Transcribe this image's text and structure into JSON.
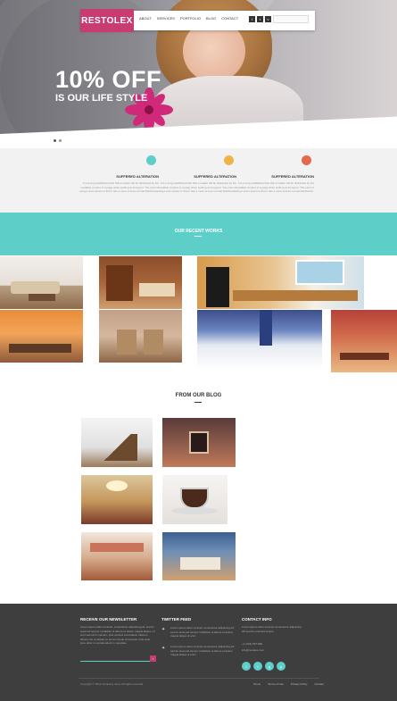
{
  "brand": {
    "logo": "RESTOLEX",
    "accent": "#c83b73",
    "teal": "#5dcfc8"
  },
  "nav": {
    "items": [
      "ABOUT",
      "SERVICES",
      "PORTFOLIO",
      "BLOG",
      "CONTACT"
    ],
    "social_icons": [
      "facebook-icon",
      "twitter-icon",
      "vimeo-icon"
    ]
  },
  "hero": {
    "title": "10% OFF",
    "subtitle": "IS OUR LIFE STYLE",
    "slides": 2,
    "active_slide": 1
  },
  "features": [
    {
      "title": "SUFFERED ALTERATION",
      "icon": "leaf-icon",
      "color": "#5dcfc8",
      "text": "It is a long established fact that a reader will be distracted by the readable content of a page when looking at its layout. The point of using Lorem Ipsum is that it has a more-or-less normal distribution."
    },
    {
      "title": "SUFFERED ALTERATION",
      "icon": "star-icon",
      "color": "#f0b34a",
      "text": "It is a long established fact that a reader will be distracted by the readable content of a page when looking at its layout. The point of using Lorem Ipsum is that it has a more-or-less normal distribution."
    },
    {
      "title": "SUFFERED ALTERATION",
      "icon": "refresh-icon",
      "color": "#e46a4d",
      "text": "It is a long established fact that a reader will be distracted by the readable content of a page when looking at its layout. The point of using Lorem Ipsum is that it has a more-or-less normal distribution."
    }
  ],
  "works": {
    "title": "OUR RECENT WORKS"
  },
  "blog": {
    "title": "FROM OUR BLOG"
  },
  "footer": {
    "newsletter": {
      "heading": "RECEIVE OUR NEWSLETTER",
      "text": "Lorem ipsum dolor sit amet, consectetur adipiscing elit, sed do eiusmod tempor incididunt ut labore et dolore magna aliqua. Ut enim ad minim veniam, quis nostrud exercitation ullamco laboris nisi ut aliquip ex ea commodo consequat. Duis aute irure dolor in reprehenderit in voluptate."
    },
    "twitter": {
      "heading": "TWITTER FEED",
      "tweets": [
        "Lorem ipsum dolor sit amet consectetur adipiscing elit sed do eiusmod tempor incididunt ut labore et dolore magna aliqua ut enim",
        "Lorem ipsum dolor sit amet consectetur adipiscing elit sed do eiusmod tempor incididunt ut labore et dolore magna aliqua ut enim"
      ]
    },
    "contact": {
      "heading": "CONTACT INFO",
      "text": "Lorem ipsum dolor sit amet consectetur adipiscing elit sed do eiusmod tempor",
      "phone": "+1 (234) 567-890",
      "email": "info@restolex.com",
      "icons": [
        "facebook-icon",
        "twitter-icon",
        "google-plus-icon",
        "pinterest-icon"
      ]
    },
    "copyright": "Copyright © 2014 Company name All rights reserved",
    "links": [
      "Terms",
      "Terms of Use",
      "Privacy Policy",
      "Contact"
    ]
  }
}
